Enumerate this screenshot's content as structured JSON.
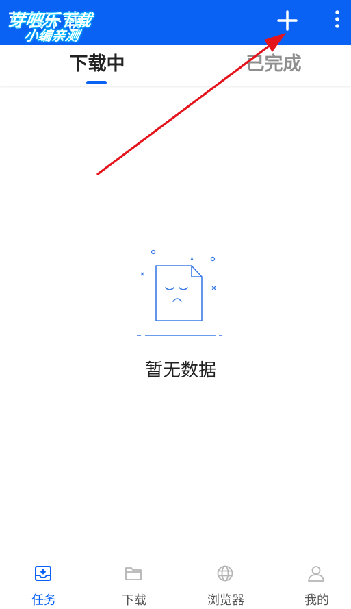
{
  "header": {
    "title": "芽芸下载",
    "watermark_line1": "芽吧乐下载",
    "watermark_line2": "小编亲测",
    "add_icon": "plus-icon",
    "more_icon": "more-vertical-icon"
  },
  "tabs": [
    {
      "label": "下载中",
      "active": true
    },
    {
      "label": "已完成",
      "active": false
    }
  ],
  "empty_state": {
    "text": "暂无数据",
    "icon": "sad-document-icon"
  },
  "bottom_nav": [
    {
      "label": "任务",
      "icon": "download-tray-icon",
      "active": true
    },
    {
      "label": "下载",
      "icon": "folder-icon",
      "active": false
    },
    {
      "label": "浏览器",
      "icon": "globe-icon",
      "active": false
    },
    {
      "label": "我的",
      "icon": "person-icon",
      "active": false
    }
  ],
  "colors": {
    "primary": "#0a62f5",
    "tab_active_text": "#222222",
    "tab_inactive_text": "#8f8f8f",
    "nav_inactive": "#b5b5b5",
    "annotation_arrow": "#e3141c"
  }
}
